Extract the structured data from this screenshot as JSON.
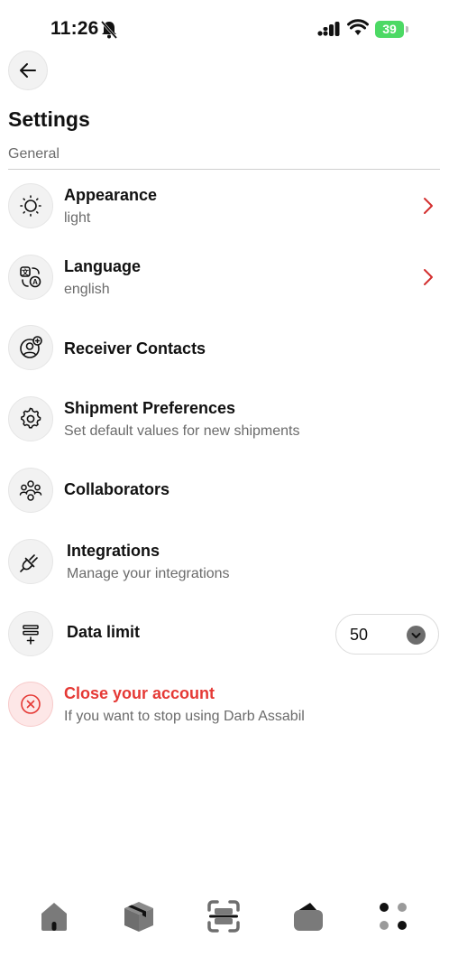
{
  "status_bar": {
    "time": "11:26",
    "battery": "39"
  },
  "header": {
    "title": "Settings",
    "section": "General"
  },
  "settings": [
    {
      "id": "appearance",
      "title": "Appearance",
      "subtitle": "light",
      "icon": "sun-icon"
    },
    {
      "id": "language",
      "title": "Language",
      "subtitle": "english",
      "icon": "translate-icon"
    },
    {
      "id": "receiver-contacts",
      "title": "Receiver Contacts",
      "icon": "user-plus-icon"
    },
    {
      "id": "shipment-preferences",
      "title": "Shipment Preferences",
      "subtitle": "Set default values for new shipments",
      "icon": "gear-icon"
    },
    {
      "id": "collaborators",
      "title": "Collaborators",
      "icon": "users-icon"
    },
    {
      "id": "integrations",
      "title": "Integrations",
      "subtitle": "Manage your integrations",
      "icon": "plug-icon"
    },
    {
      "id": "data-limit",
      "title": "Data limit",
      "value": "50",
      "icon": "list-add-icon"
    },
    {
      "id": "close-account",
      "title": "Close your account",
      "subtitle": "If you want to stop using Darb Assabil",
      "icon": "close-circle-icon"
    }
  ],
  "bottom_nav": [
    {
      "id": "home",
      "icon": "home-icon"
    },
    {
      "id": "shipments",
      "icon": "package-icon"
    },
    {
      "id": "scan",
      "icon": "scan-icon"
    },
    {
      "id": "wallet",
      "icon": "wallet-icon"
    },
    {
      "id": "more",
      "icon": "grid-dots-icon"
    }
  ],
  "colors": {
    "danger": "#e53935",
    "chevron": "#d32f2f",
    "battery": "#4cd964"
  }
}
